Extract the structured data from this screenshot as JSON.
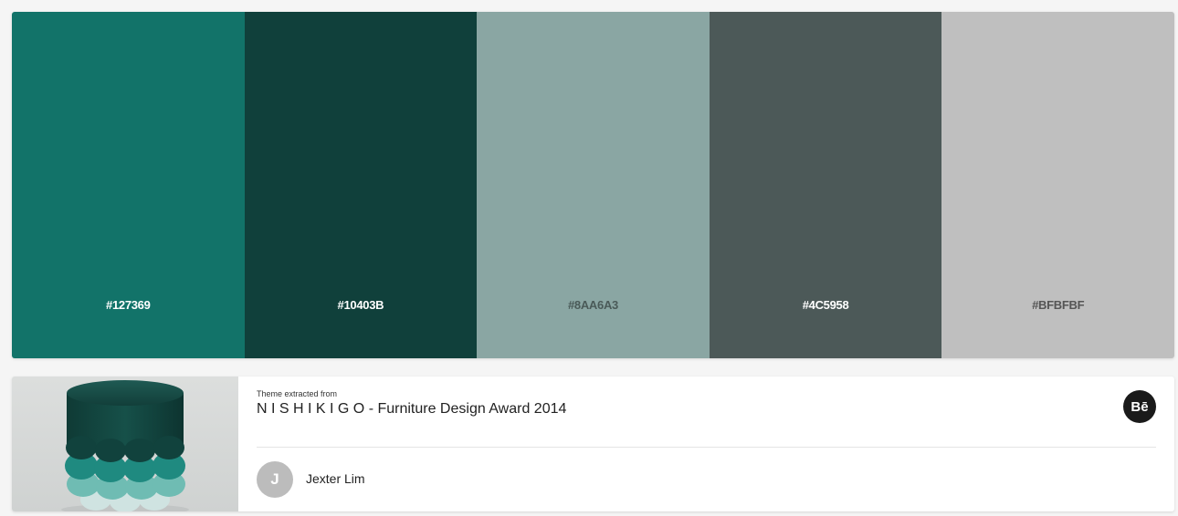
{
  "palette": {
    "swatches": [
      {
        "hex": "#127369",
        "color": "#127369",
        "text_color": "#ffffff"
      },
      {
        "hex": "#10403B",
        "color": "#10403B",
        "text_color": "#ffffff"
      },
      {
        "hex": "#8AA6A3",
        "color": "#8AA6A3",
        "text_color": "#4a5a58"
      },
      {
        "hex": "#4C5958",
        "color": "#4C5958",
        "text_color": "#ffffff"
      },
      {
        "hex": "#BFBFBF",
        "color": "#BFBFBF",
        "text_color": "#555555"
      }
    ]
  },
  "theme_info": {
    "extracted_label": "Theme extracted from",
    "project_title": "N I S H I K I G O - Furniture Design Award 2014",
    "author_initial": "J",
    "author_name": "Jexter Lim",
    "behance_label": "Bē"
  },
  "thumbnail": {
    "icon": "stool-scales-image"
  }
}
